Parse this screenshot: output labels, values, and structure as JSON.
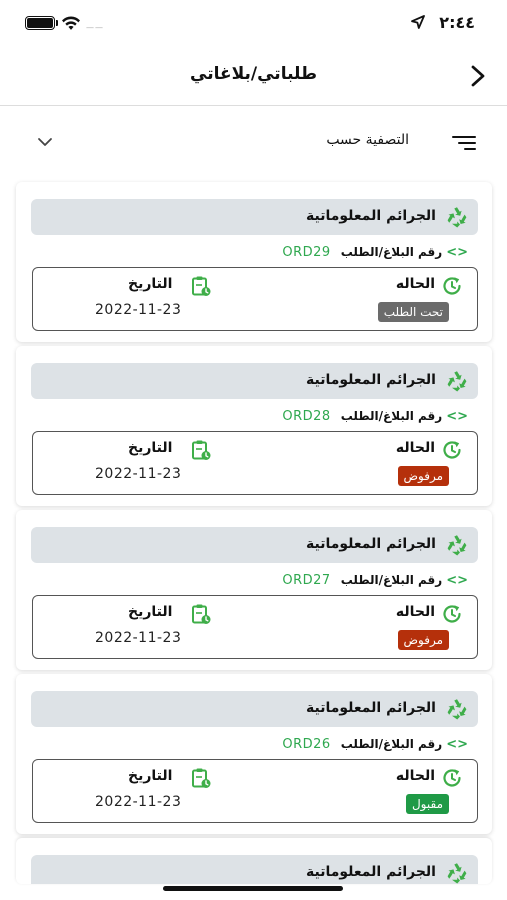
{
  "status_bar": {
    "time": "٢:٤٤",
    "carrier": "——"
  },
  "nav": {
    "title": "طلباتي/بلاغاتي"
  },
  "filter": {
    "label": "التصفية حسب"
  },
  "labels": {
    "status": "الحاله",
    "date": "التاريخ",
    "order": "رقم البلاغ/الطلب"
  },
  "colors": {
    "accent_green": "#2fa84f",
    "pending": "#6b6b6b",
    "rejected": "#b5300b",
    "accepted": "#1f9a46",
    "card_header": "#dde2e6"
  },
  "cards": [
    {
      "category": "الجرائم المعلوماتية",
      "order_no": "ORD29",
      "status": "تحت الطلب",
      "status_color": "#6b6b6b",
      "date": "2022-11-23"
    },
    {
      "category": "الجرائم المعلوماتية",
      "order_no": "ORD28",
      "status": "مرفوض",
      "status_color": "#b5300b",
      "date": "2022-11-23"
    },
    {
      "category": "الجرائم المعلوماتية",
      "order_no": "ORD27",
      "status": "مرفوض",
      "status_color": "#b5300b",
      "date": "2022-11-23"
    },
    {
      "category": "الجرائم المعلوماتية",
      "order_no": "ORD26",
      "status": "مقبول",
      "status_color": "#1f9a46",
      "date": "2022-11-23"
    },
    {
      "category": "الجرائم المعلوماتية"
    }
  ],
  "icons": {
    "back": "chevron-right-icon",
    "filter": "filter-lines-icon",
    "dropdown": "chevron-down-icon",
    "category": "recycle-icon",
    "order": "code-brackets-icon",
    "status": "refresh-clock-icon",
    "date": "clipboard-clock-icon"
  }
}
